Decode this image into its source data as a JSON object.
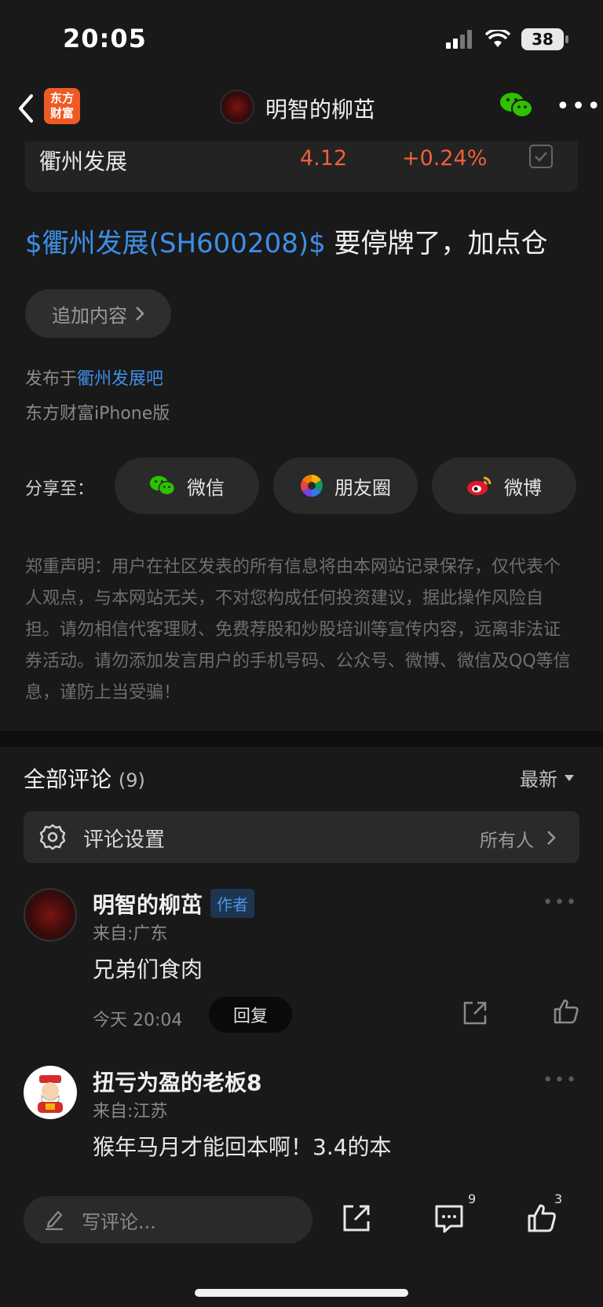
{
  "status_bar": {
    "time": "20:05",
    "battery": "38"
  },
  "nav": {
    "title": "明智的柳茁",
    "app_logo_line1": "东方",
    "app_logo_line2": "财富"
  },
  "stock": {
    "name": "衢州发展",
    "price": "4.12",
    "change": "+0.24%"
  },
  "post": {
    "stock_link": "$衢州发展(SH600208)$",
    "text": " 要停牌了，加点仓",
    "add_content": "追加内容",
    "published_prefix": "发布于",
    "published_bar": "衢州发展吧",
    "device": "东方财富iPhone版"
  },
  "share": {
    "label": "分享至：",
    "wechat": "微信",
    "moments": "朋友圈",
    "weibo": "微博"
  },
  "disclaimer": "郑重声明：用户在社区发表的所有信息将由本网站记录保存，仅代表个人观点，与本网站无关，不对您构成任何投资建议，据此操作风险自担。请勿相信代客理财、免费荐股和炒股培训等宣传内容，远离非法证券活动。请勿添加发言用户的手机号码、公众号、微博、微信及QQ等信息，谨防上当受骗！",
  "comments": {
    "title": "全部评论",
    "count": "(9)",
    "sort": "最新",
    "settings_label": "评论设置",
    "settings_value": "所有人",
    "items": [
      {
        "name": "明智的柳茁",
        "tag": "作者",
        "location": "来自:广东",
        "text": "兄弟们食肉",
        "time": "今天 20:04",
        "reply": "回复"
      },
      {
        "name": "扭亏为盈的老板8",
        "location": "来自:江苏",
        "text": "猴年马月才能回本啊！3.4的本"
      }
    ]
  },
  "bottom_bar": {
    "placeholder": "写评论...",
    "comment_count": "9",
    "like_count": "3"
  },
  "colors": {
    "accent_blue": "#3d8fe8",
    "price_up": "#f0603a",
    "brand_orange": "#ef5a24",
    "wechat_green": "#2dc100"
  }
}
